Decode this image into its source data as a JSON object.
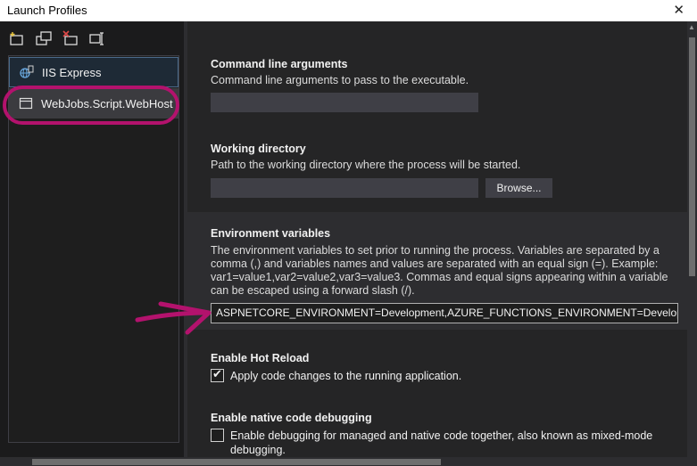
{
  "window": {
    "title": "Launch Profiles",
    "close_glyph": "✕"
  },
  "toolbar": {
    "icons": [
      "new-profile-icon",
      "copy-profile-icon",
      "delete-profile-icon",
      "rename-profile-icon"
    ]
  },
  "profiles": [
    {
      "label": "IIS Express",
      "icon": "globe-server-icon"
    },
    {
      "label": "WebJobs.Script.WebHost",
      "icon": "window-icon",
      "selected": true
    }
  ],
  "settings": {
    "cmd_args": {
      "title": "Command line arguments",
      "description": "Command line arguments to pass to the executable.",
      "value": ""
    },
    "working_dir": {
      "title": "Working directory",
      "description": "Path to the working directory where the process will be started.",
      "value": "",
      "browse_label": "Browse..."
    },
    "env_vars": {
      "title": "Environment variables",
      "description_lines": [
        "The environment variables to set prior to running the process. Variables are separated by a",
        "comma (,) and variables names and values are separated with an equal sign (=). Example:",
        "var1=value1,var2=value2,var3=value3. Commas and equal signs appearing within a variable",
        "can be escaped using a forward slash (/)."
      ],
      "value": "ASPNETCORE_ENVIRONMENT=Development,AZURE_FUNCTIONS_ENVIRONMENT=Development"
    },
    "hot_reload": {
      "title": "Enable Hot Reload",
      "checkbox_label": "Apply code changes to the running application.",
      "checked": true
    },
    "native_debug": {
      "title": "Enable native code debugging",
      "checkbox_label_lines": [
        "Enable debugging for managed and native code together, also known as mixed-mode",
        "debugging."
      ],
      "checked": false
    }
  },
  "colors": {
    "annotation": "#b3126d",
    "background": "#252526",
    "accent_border": "#4a6a8a"
  }
}
